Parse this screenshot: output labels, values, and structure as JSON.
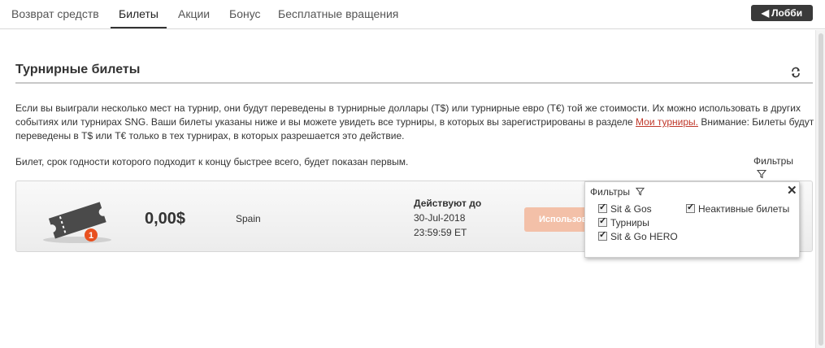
{
  "tabs": [
    {
      "label": "Возврат средств"
    },
    {
      "label": "Билеты"
    },
    {
      "label": "Акции"
    },
    {
      "label": "Бонус"
    },
    {
      "label": "Бесплатные вращения"
    }
  ],
  "active_tab": "Билеты",
  "lobby_button": {
    "arrow": "◀",
    "label": "Лобби"
  },
  "section": {
    "title": "Турнирные билеты"
  },
  "info": {
    "text_before_link": "Если вы выиграли несколько мест на турнир, они будут переведены в турнирные доллары (T$) или турнирные евро (T€) той же стоимости. Их можно использовать в других событиях или турнирах SNG. Ваши билеты указаны ниже и вы можете увидеть все турниры, в которых вы зарегистрированы в разделе ",
    "link_text": "Мои турниры.",
    "text_after_link": " Внимание: Билеты будут переведены в T$ или T€ только в тех турнирах, в которых разрешается это действие."
  },
  "sort_note": "Билет, срок годности которого подходит к концу быстрее всего, будет показан первым.",
  "filters": {
    "label": "Фильтры"
  },
  "ticket": {
    "count_badge": "1",
    "amount": "0,00$",
    "name": "Spain",
    "valid_title": "Действуют до",
    "valid_date": "30-Jul-2018",
    "valid_time": "23:59:59 ET",
    "use_button": "Использовать"
  },
  "filter_popup": {
    "title": "Фильтры",
    "close": "✕",
    "options": [
      {
        "label": "Sit & Gos",
        "checked": true
      },
      {
        "label": "Турниры",
        "checked": true
      },
      {
        "label": "Sit & Go HERO",
        "checked": true
      },
      {
        "label": "Неактивные билеты",
        "checked": true
      }
    ]
  },
  "colors": {
    "accent": "#c0392b",
    "button_disabled": "#f3c0a8",
    "badge": "#e8501f"
  }
}
